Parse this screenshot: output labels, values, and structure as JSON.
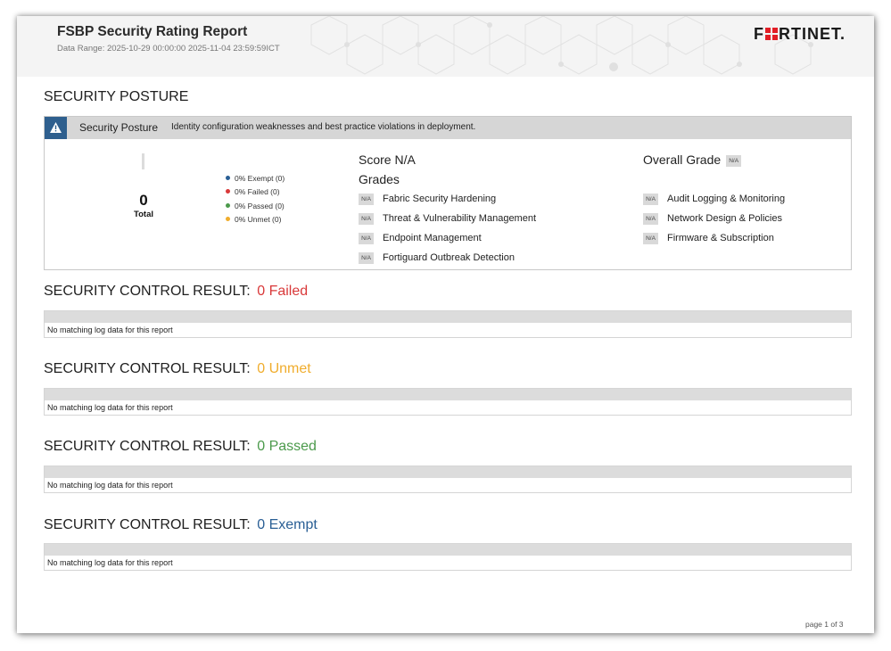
{
  "header": {
    "title": "FSBP Security Rating Report",
    "date_range": "Data Range: 2025-10-29 00:00:00 2025-11-04 23:59:59ICT",
    "logo_left": "F",
    "logo_right": "RTINET."
  },
  "posture": {
    "section_title": "SECURITY POSTURE",
    "bar_label": "Security Posture",
    "bar_desc": "Identity configuration weaknesses and best practice violations in deployment.",
    "total_value": "0",
    "total_label": "Total",
    "legend": [
      {
        "label": "0% Exempt (0)",
        "color": "#2a5f95"
      },
      {
        "label": "0% Failed (0)",
        "color": "#d9393a"
      },
      {
        "label": "0% Passed (0)",
        "color": "#4b9a4b"
      },
      {
        "label": "0% Unmet (0)",
        "color": "#f0ad2d"
      }
    ],
    "score": "Score N/A",
    "grades_title": "Grades",
    "overall_label": "Overall Grade",
    "overall_value": "N/A",
    "grades_left": [
      {
        "badge": "N/A",
        "name": "Fabric Security Hardening"
      },
      {
        "badge": "N/A",
        "name": "Threat & Vulnerability Management"
      },
      {
        "badge": "N/A",
        "name": "Endpoint Management"
      },
      {
        "badge": "N/A",
        "name": "Fortiguard Outbreak Detection"
      }
    ],
    "grades_right": [
      {
        "badge": "N/A",
        "name": "Audit Logging & Monitoring"
      },
      {
        "badge": "N/A",
        "name": "Network Design & Policies"
      },
      {
        "badge": "N/A",
        "name": "Firmware & Subscription"
      }
    ]
  },
  "results": [
    {
      "prefix": "SECURITY CONTROL RESULT:",
      "count": "0",
      "status": "Failed",
      "color": "#d9393a",
      "message": "No matching log data for this report"
    },
    {
      "prefix": "SECURITY CONTROL RESULT:",
      "count": "0",
      "status": "Unmet",
      "color": "#f0ad2d",
      "message": "No matching log data for this report"
    },
    {
      "prefix": "SECURITY CONTROL RESULT:",
      "count": "0",
      "status": "Passed",
      "color": "#4b9a4b",
      "message": "No matching log data for this report"
    },
    {
      "prefix": "SECURITY CONTROL RESULT:",
      "count": "0",
      "status": "Exempt",
      "color": "#2a5f95",
      "message": "No matching log data for this report"
    }
  ],
  "footer": {
    "page": "page 1 of 3"
  }
}
